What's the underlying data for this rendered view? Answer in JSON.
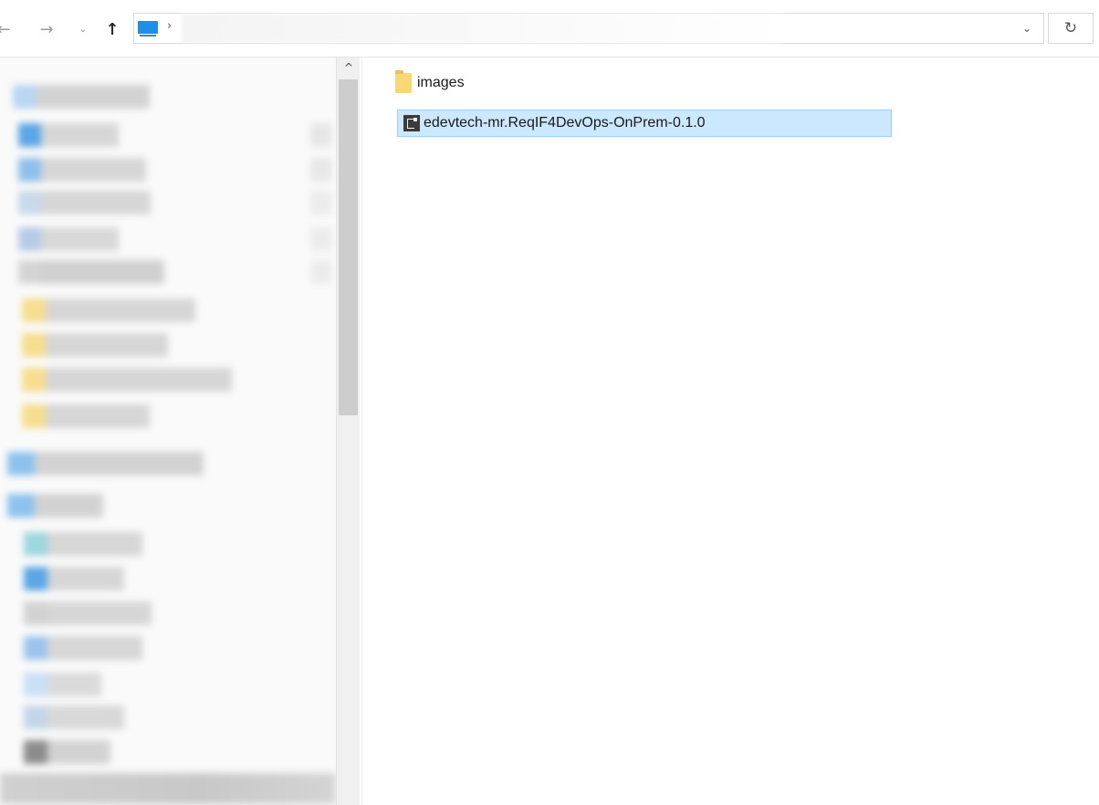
{
  "navbar": {
    "back_icon": "←",
    "forward_icon": "→",
    "recent_icon": "⌄",
    "up_icon": "↑",
    "breadcrumb_separator": "›",
    "dropdown_icon": "⌄",
    "refresh_icon": "↻"
  },
  "files": [
    {
      "name": "images",
      "type": "folder",
      "selected": false
    },
    {
      "name": "edevtech-mr.ReqIF4DevOps-OnPrem-0.1.0",
      "type": "file",
      "selected": true
    }
  ],
  "colors": {
    "selection_bg": "#cce8ff",
    "selection_border": "#99d1ff",
    "folder": "#f8d876",
    "pc_icon": "#1e8fe6"
  }
}
